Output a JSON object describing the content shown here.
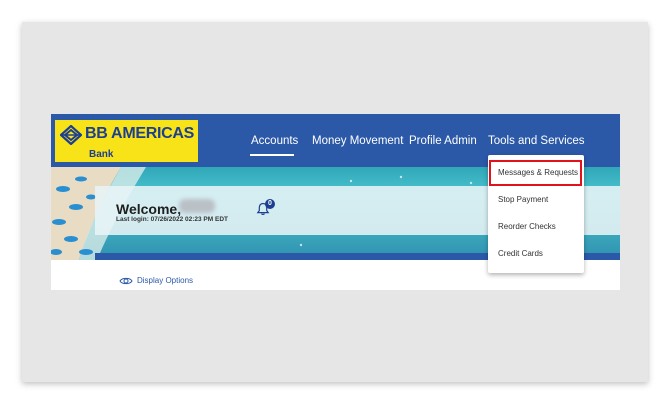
{
  "brand": {
    "name": "BB AMERICAS",
    "subtitle": "Bank",
    "logo_color": "#f7e317",
    "brand_color": "#1d3f92"
  },
  "nav": {
    "items": [
      {
        "label": "Accounts",
        "active": true
      },
      {
        "label": "Money Movement"
      },
      {
        "label": "Profile Admin"
      },
      {
        "label": "Tools and Services"
      }
    ]
  },
  "welcome": {
    "title": "Welcome,",
    "last_login": "Last login: 07/26/2022 02:23 PM EDT",
    "notification_count": "0"
  },
  "content": {
    "display_options_label": "Display Options"
  },
  "dropdown": {
    "items": [
      {
        "label": "Messages & Requests",
        "highlighted": true
      },
      {
        "label": "Stop Payment"
      },
      {
        "label": "Reorder Checks"
      },
      {
        "label": "Credit Cards"
      }
    ]
  },
  "colors": {
    "header": "#2b59a8",
    "highlight_border": "#e0121b"
  }
}
